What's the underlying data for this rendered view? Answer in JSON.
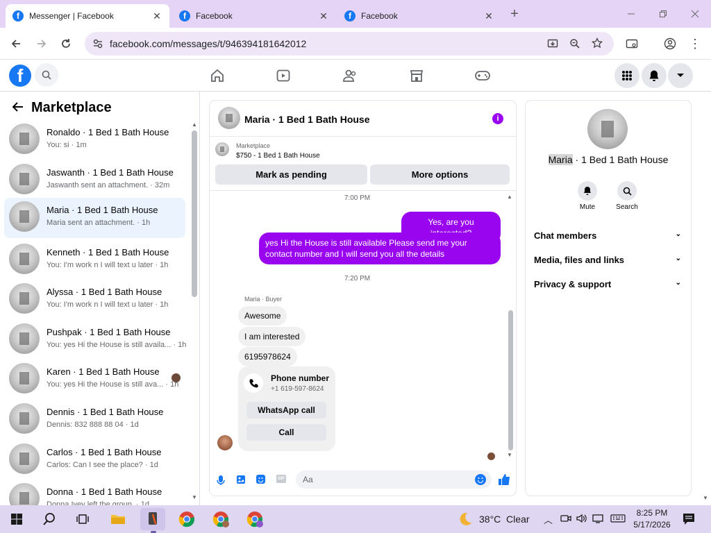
{
  "browser": {
    "tabs": [
      {
        "title": "Messenger | Facebook"
      },
      {
        "title": "Facebook"
      },
      {
        "title": "Facebook"
      }
    ],
    "url": "facebook.com/messages/t/946394181642012"
  },
  "sidebar": {
    "title": "Marketplace",
    "conversations": [
      {
        "name": "Ronaldo · 1 Bed 1 Bath House",
        "preview": "You: si · 1m"
      },
      {
        "name": "Jaswanth · 1 Bed 1 Bath House",
        "preview": "Jaswanth sent an attachment. · 32m"
      },
      {
        "name": "Maria · 1 Bed 1 Bath House",
        "preview": "Maria sent an attachment. · 1h"
      },
      {
        "name": "Kenneth · 1 Bed 1 Bath House",
        "preview": "You: I'm work n I will text u later · 1h"
      },
      {
        "name": "Alyssa · 1 Bed 1 Bath House",
        "preview": "You: I'm work n I will text u later · 1h"
      },
      {
        "name": "Pushpak · 1 Bed 1 Bath House",
        "preview": "You: yes Hi the House is still availa... · 1h"
      },
      {
        "name": "Karen · 1 Bed 1 Bath House",
        "preview": "You: yes Hi the House is still ava... · 1h"
      },
      {
        "name": "Dennis · 1 Bed 1 Bath House",
        "preview": "Dennis: 832 888 88 04 · 1d"
      },
      {
        "name": "Carlos · 1 Bed 1 Bath House",
        "preview": "Carlos: Can I see the place? · 1d"
      },
      {
        "name": "Donna · 1 Bed 1 Bath House",
        "preview": "Donna Ivey left the group. · 1d"
      }
    ]
  },
  "chat": {
    "title": "Maria · 1 Bed 1 Bath House",
    "listing_label": "Marketplace",
    "listing_price": "$750 - 1 Bed 1 Bath House",
    "mark_pending": "Mark as pending",
    "more_options": "More options",
    "time1": "7:00 PM",
    "out1": "Yes, are you interested?",
    "out2": "yes Hi the  House is still available Please send me your contact number and I will send you all the details",
    "time2": "7:20 PM",
    "sender": "Maria · Buyer",
    "in1": "Awesome",
    "in2": "I am interested",
    "in3": "6195978624",
    "card_title": "Phone number",
    "card_number": "+1 619-597-8624",
    "whatsapp": "WhatsApp call",
    "call": "Call",
    "composer_placeholder": "Aa"
  },
  "panel": {
    "name_highlight": "Maria",
    "name_rest": " · 1 Bed 1 Bath House",
    "mute": "Mute",
    "search": "Search",
    "sections": [
      "Chat members",
      "Media, files and links",
      "Privacy & support"
    ]
  },
  "taskbar": {
    "weather": "38°C  Clear",
    "time": "8:25 PM",
    "date": "5/17/2026"
  },
  "colors": {
    "facebook_blue": "#1877f2",
    "messenger_purple": "#9a05f0",
    "selected_row": "#ebf3ff"
  }
}
